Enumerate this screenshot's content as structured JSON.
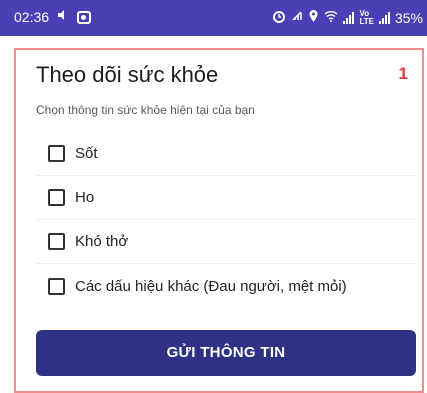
{
  "status_bar": {
    "time": "02:36",
    "battery": "35%",
    "left_icons": [
      "volume-icon",
      "gallery-icon"
    ],
    "right_icons": [
      "alarm-icon",
      "signal-muted-icon",
      "location-icon",
      "wifi-icon",
      "cellular-signal-icon",
      "volte-icon",
      "cellular-signal-icon"
    ],
    "volte_label": "Vo\nLTE",
    "background_color": "#4a3fb4"
  },
  "card": {
    "title": "Theo dõi sức khỏe",
    "badge": "1",
    "subtitle": "Chọn thông tin sức khỏe hiện tại của bạn",
    "border_color": "#f08c8c",
    "options": [
      {
        "label": "Sốt",
        "checked": false
      },
      {
        "label": "Ho",
        "checked": false
      },
      {
        "label": "Khó thở",
        "checked": false
      },
      {
        "label": "Các dấu hiệu khác (Đau người, mệt mỏi)",
        "checked": false
      }
    ],
    "submit_label": "GỬI THÔNG TIN",
    "submit_color": "#2f3185"
  }
}
